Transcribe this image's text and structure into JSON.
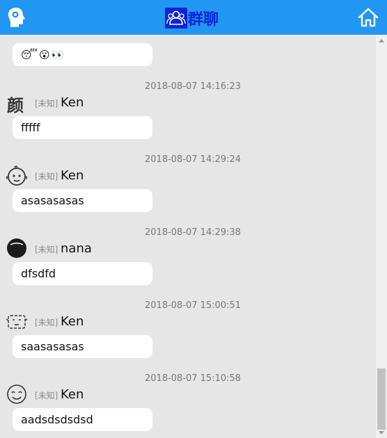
{
  "header": {
    "title": "群聊",
    "left_icon": "head-icon",
    "right_icon": "home-icon",
    "bg_color": "#2196f3",
    "title_color": "#0a24d8"
  },
  "first_message": {
    "text": "😴😮👀"
  },
  "messages": [
    {
      "time": "2018-08-07 14:16:23",
      "tag": "[未知]",
      "name": "Ken",
      "text": "fffff",
      "avatar": "yan-glyph-avatar"
    },
    {
      "time": "2018-08-07 14:29:24",
      "tag": "[未知]",
      "name": "Ken",
      "text": "asasasasas",
      "avatar": "baby-face-avatar"
    },
    {
      "time": "2018-08-07 14:29:38",
      "tag": "[未知]",
      "name": "nana",
      "text": "dfsdfd",
      "avatar": "dark-circle-avatar"
    },
    {
      "time": "2018-08-07 15:00:51",
      "tag": "[未知]",
      "name": "Ken",
      "text": "saasasasas",
      "avatar": "box-face-avatar"
    },
    {
      "time": "2018-08-07 15:10:58",
      "tag": "[未知]",
      "name": "Ken",
      "text": "aadsdsdsdsd",
      "avatar": "smile-face-avatar"
    }
  ]
}
